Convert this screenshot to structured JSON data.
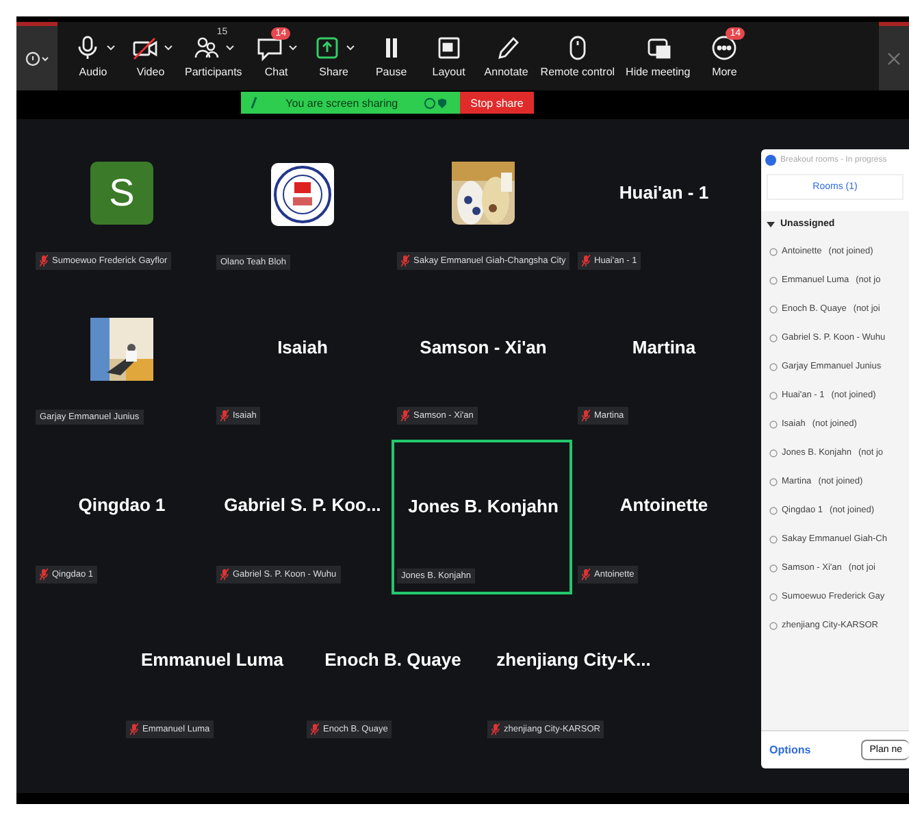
{
  "toolbar": {
    "items": [
      {
        "label": "Audio",
        "caret": true
      },
      {
        "label": "Video",
        "caret": true
      },
      {
        "label": "Participants",
        "caret": true,
        "count": "15"
      },
      {
        "label": "Chat",
        "caret": true,
        "badge": "14"
      },
      {
        "label": "Share",
        "caret": true
      },
      {
        "label": "Pause",
        "caret": false
      },
      {
        "label": "Layout",
        "caret": false
      },
      {
        "label": "Annotate",
        "caret": false
      },
      {
        "label": "Remote control",
        "caret": false
      },
      {
        "label": "Hide meeting",
        "caret": false
      },
      {
        "label": "More",
        "caret": false,
        "badge": "14"
      }
    ]
  },
  "sharing_banner": {
    "text": "You are screen sharing",
    "stop": "Stop share"
  },
  "rows": [
    {
      "tiles": [
        {
          "kind": "letter",
          "letter": "S",
          "label": "Sumoewuo Frederick Gayflor",
          "muted": true,
          "active": false
        },
        {
          "kind": "logo",
          "label": "Olano Teah Bloh",
          "muted": false,
          "active": false
        },
        {
          "kind": "picture",
          "label": "Sakay Emmanuel Giah-Changsha City",
          "muted": true,
          "active": false
        },
        {
          "kind": "name",
          "display": "Huai'an - 1",
          "label": "Huai'an - 1",
          "muted": true,
          "active": false
        }
      ]
    },
    {
      "tiles": [
        {
          "kind": "picture",
          "label": "Garjay Emmanuel Junius",
          "muted": false,
          "active": false
        },
        {
          "kind": "name",
          "display": "Isaiah",
          "label": "Isaiah",
          "muted": true,
          "active": false
        },
        {
          "kind": "name",
          "display": "Samson - Xi'an",
          "label": "Samson - Xi'an",
          "muted": true,
          "active": false
        },
        {
          "kind": "name",
          "display": "Martina",
          "label": "Martina",
          "muted": true,
          "active": false
        }
      ]
    },
    {
      "tiles": [
        {
          "kind": "name",
          "display": "Qingdao 1",
          "label": "Qingdao 1",
          "muted": true,
          "active": false
        },
        {
          "kind": "name",
          "display": "Gabriel S. P. Koo...",
          "label": "Gabriel S. P. Koon - Wuhu",
          "muted": true,
          "active": false
        },
        {
          "kind": "name",
          "display": "Jones B. Konjahn",
          "label": "Jones B. Konjahn",
          "muted": false,
          "active": true
        },
        {
          "kind": "name",
          "display": "Antoinette",
          "label": "Antoinette",
          "muted": true,
          "active": false
        }
      ]
    },
    {
      "tiles": [
        {
          "kind": "name",
          "display": "Emmanuel Luma",
          "label": "Emmanuel Luma",
          "muted": true,
          "active": false
        },
        {
          "kind": "name",
          "display": "Enoch B. Quaye",
          "label": "Enoch B. Quaye",
          "muted": true,
          "active": false
        },
        {
          "kind": "name",
          "display": "zhenjiang  City-K...",
          "label": "zhenjiang City-KARSOR",
          "muted": true,
          "active": false
        }
      ]
    }
  ],
  "breakout_panel": {
    "title": "Breakout rooms - In progress",
    "tab": "Rooms (1)",
    "group": {
      "name": "Unassigned",
      "expanded": true,
      "members": [
        {
          "name": "Antoinette",
          "status": "(not joined)",
          "checked": false
        },
        {
          "name": "Emmanuel Luma",
          "status": "(not jo",
          "checked": false
        },
        {
          "name": "Enoch B. Quaye",
          "status": "(not joi",
          "checked": false
        },
        {
          "name": "Gabriel S. P. Koon - Wuhu",
          "checked": false
        },
        {
          "name": "Garjay Emmanuel Junius",
          "checked": false
        },
        {
          "name": "Huai'an - 1",
          "status": "(not joined)",
          "checked": false
        },
        {
          "name": "Isaiah",
          "status": "(not joined)",
          "checked": false
        },
        {
          "name": "Jones B. Konjahn",
          "status": "(not jo",
          "checked": false
        },
        {
          "name": "Martina",
          "status": "(not joined)",
          "checked": false
        },
        {
          "name": "Qingdao 1",
          "status": "(not joined)",
          "checked": false
        },
        {
          "name": "Sakay Emmanuel Giah-Ch",
          "checked": false
        },
        {
          "name": "Samson - Xi'an",
          "status": "(not joi",
          "checked": false
        },
        {
          "name": "Sumoewuo Frederick Gay",
          "checked": false
        },
        {
          "name": "zhenjiang City-KARSOR",
          "checked": false
        }
      ]
    },
    "options": "Options",
    "plan": "Plan ne"
  }
}
